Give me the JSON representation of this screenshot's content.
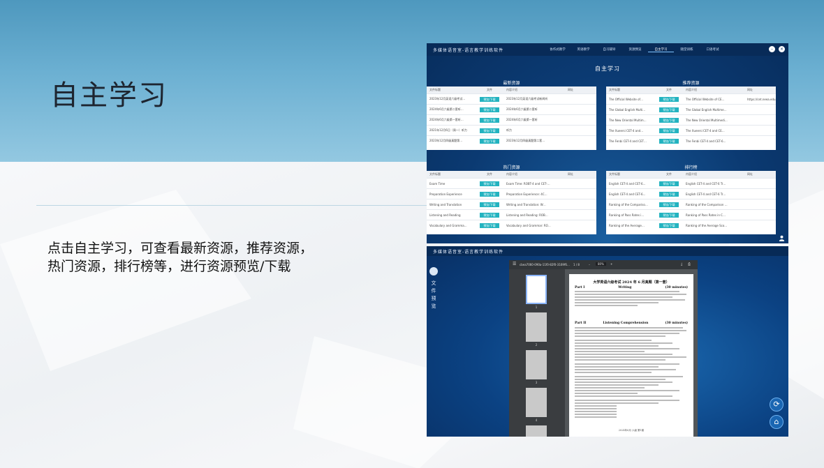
{
  "slide": {
    "title": "自主学习",
    "description": "点击自主学习，可查看最新资源，推荐资源，热门资源，排行榜等，进行资源预览/下载"
  },
  "app": {
    "brand": "多媒体语音室-语言教学训练软件",
    "nav": [
      "协作式教学",
      "英语教学",
      "自习辅导",
      "资源预览",
      "自主学习",
      "随堂训练",
      "口语考试"
    ],
    "active_nav": "自主学习",
    "page_title": "自主学习",
    "columns": [
      "文件标题",
      "文件",
      "内容介绍",
      "网址"
    ],
    "button_label": "预览/下载",
    "panels": {
      "latest": {
        "title": "最新资源",
        "rows": [
          {
            "title": "2023年12月英语六级考试…",
            "intro": "2023年12月英语六级考试新闻听",
            "url": ""
          },
          {
            "title": "2024年6月六级第二套听…",
            "intro": "2024年6月六级第二套听",
            "url": ""
          },
          {
            "title": "2024年6月六级第一套听…",
            "intro": "2024年6月六级第一套听",
            "url": ""
          },
          {
            "title": "2021年12月6日（周一）听力",
            "intro": "听力",
            "url": ""
          },
          {
            "title": "2023年12月四级真题第…",
            "intro": "2023年12月四级真题第二套…",
            "url": ""
          }
        ]
      },
      "recommended": {
        "title": "推荐资源",
        "rows": [
          {
            "title": "The Official Website of…",
            "intro": "The Official Website of CE…",
            "url": "https://cet.neea.edu.cn/"
          },
          {
            "title": "The Global English Multi…",
            "intro": "The Global English Multime…",
            "url": ""
          },
          {
            "title": "The New Oriental Multim…",
            "intro": "The New Oriental Multimedi…",
            "url": ""
          },
          {
            "title": "The Xueersi CET-4 and…",
            "intro": "The Xueersi CET-4 and CE…",
            "url": ""
          },
          {
            "title": "The Fenbi CET-4 and CET…",
            "intro": "The Fenbi CET-4 and CET-6…",
            "url": ""
          }
        ]
      },
      "popular": {
        "title": "热门资源",
        "rows": [
          {
            "title": "Exam Time",
            "intro": "Exam Time: ROBT-4 and CET-…",
            "url": ""
          },
          {
            "title": "Preparation Experience",
            "intro": "Preparation Experience: 4C…",
            "url": ""
          },
          {
            "title": "Writing and Translation",
            "intro": "Writing and Translation: W…",
            "url": ""
          },
          {
            "title": "Listening and Reading",
            "intro": "Listening and Reading: ROB…",
            "url": ""
          },
          {
            "title": "Vocabulary and Gramma…",
            "intro": "Vocabulary and Grammar: RO…",
            "url": ""
          }
        ]
      },
      "ranking": {
        "title": "排行榜",
        "rows": [
          {
            "title": "English CET-4 and CET-6…",
            "intro": "English CET-4 and CET-6 Tr…",
            "url": ""
          },
          {
            "title": "English CET-4 and CET-6…",
            "intro": "English CET-4 and CET-6 Tr…",
            "url": ""
          },
          {
            "title": "Ranking of the Compariso…",
            "intro": "Ranking of the Comparison …",
            "url": ""
          },
          {
            "title": "Ranking of Pass Rates i…",
            "intro": "Ranking of Pass Rates in C…",
            "url": ""
          },
          {
            "title": "Ranking of the Average…",
            "intro": "Ranking of the Average Sco…",
            "url": ""
          }
        ]
      }
    }
  },
  "preview": {
    "side_label": "文件预览",
    "file_name": "cbea7060-090a-11f0-82f0-3169f6…",
    "page_indicator": "1 / 8",
    "zoom": "80%",
    "doc_title": "大学英语六级考试 2024 年 6 月真题（第一套）",
    "part1": "Part I",
    "part1_name": "Writing",
    "part1_time": "(30 minutes)",
    "part2": "Part II",
    "part2_name": "Listening Comprehension",
    "part2_time": "(30 minutes)",
    "thumb_numbers": [
      "1",
      "2",
      "3",
      "4",
      "5"
    ],
    "footer": "2024年6月 六级 第1套"
  }
}
